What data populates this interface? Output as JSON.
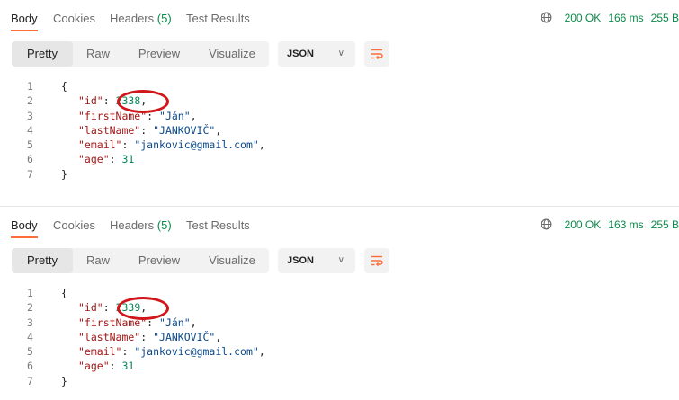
{
  "responses": [
    {
      "tabs": {
        "body": "Body",
        "cookies": "Cookies",
        "headers": "Headers",
        "headers_count": "(5)",
        "test_results": "Test Results"
      },
      "status": {
        "code": "200 OK",
        "time": "166 ms",
        "size": "255 B"
      },
      "views": {
        "pretty": "Pretty",
        "raw": "Raw",
        "preview": "Preview",
        "visualize": "Visualize"
      },
      "format": "JSON",
      "lines": [
        "1",
        "2",
        "3",
        "4",
        "5",
        "6",
        "7"
      ],
      "json": {
        "open": "{",
        "close": "}",
        "id_key": "\"id\"",
        "id_val": "2338",
        "first_key": "\"firstName\"",
        "first_val": "\"Ján\"",
        "last_key": "\"lastName\"",
        "last_val": "\"JANKOVIČ\"",
        "email_key": "\"email\"",
        "email_val": "\"jankovic@gmail.com\"",
        "age_key": "\"age\"",
        "age_val": "31"
      }
    },
    {
      "tabs": {
        "body": "Body",
        "cookies": "Cookies",
        "headers": "Headers",
        "headers_count": "(5)",
        "test_results": "Test Results"
      },
      "status": {
        "code": "200 OK",
        "time": "163 ms",
        "size": "255 B"
      },
      "views": {
        "pretty": "Pretty",
        "raw": "Raw",
        "preview": "Preview",
        "visualize": "Visualize"
      },
      "format": "JSON",
      "lines": [
        "1",
        "2",
        "3",
        "4",
        "5",
        "6",
        "7"
      ],
      "json": {
        "open": "{",
        "close": "}",
        "id_key": "\"id\"",
        "id_val": "2339",
        "first_key": "\"firstName\"",
        "first_val": "\"Ján\"",
        "last_key": "\"lastName\"",
        "last_val": "\"JANKOVIČ\"",
        "email_key": "\"email\"",
        "email_val": "\"jankovic@gmail.com\"",
        "age_key": "\"age\"",
        "age_val": "31"
      }
    }
  ],
  "colors": {
    "accent": "#ff6c37",
    "status_green": "#0a8a4a",
    "annotation_red": "#d0161a"
  },
  "icons": {
    "globe": "globe-icon",
    "chevron": "chevron-down-icon",
    "wrap": "wrap-lines-icon"
  }
}
